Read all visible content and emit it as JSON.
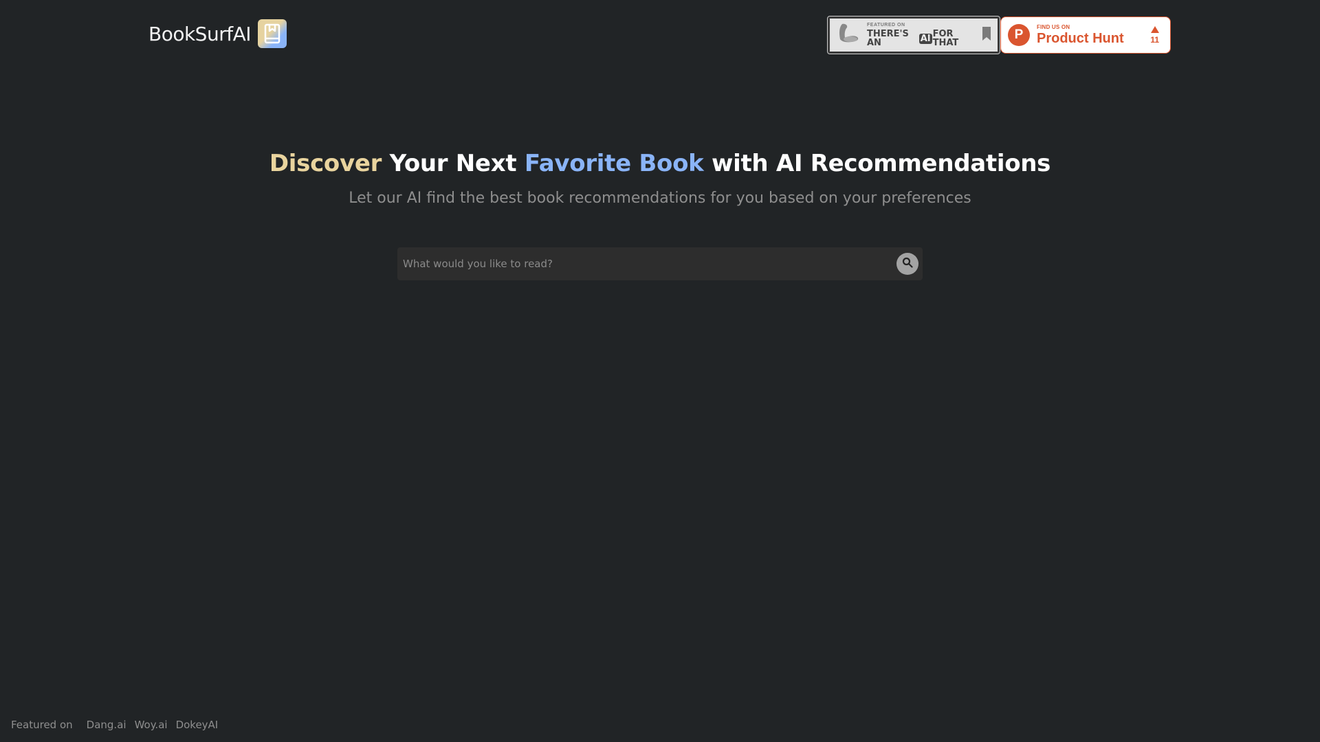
{
  "header": {
    "brand_name": "BookSurfAI",
    "logo_icon": "book-bookmark-icon",
    "badges": {
      "taaft": {
        "small": "FEATURED ON",
        "pre": "THERE'S AN",
        "ai": "AI",
        "post": "FOR THAT"
      },
      "product_hunt": {
        "small": "FIND US ON",
        "big": "Product Hunt",
        "logo_letter": "P",
        "votes": "11",
        "color": "#da552f"
      }
    }
  },
  "hero": {
    "title_parts": {
      "p1": "Discover",
      "p2": " Your Next ",
      "p3": "Favorite Book",
      "p4": " with AI Recommendations"
    },
    "subtitle": "Let our AI find the best book recommendations for you based on your preferences",
    "accent_gold": "#e9d49e",
    "accent_blue": "#8ab4f8"
  },
  "search": {
    "value": "",
    "placeholder": "What would you like to read?",
    "button_icon": "search-icon"
  },
  "footer": {
    "label": "Featured on",
    "links": [
      "Dang.ai",
      "Woy.ai",
      "DokeyAI"
    ]
  }
}
